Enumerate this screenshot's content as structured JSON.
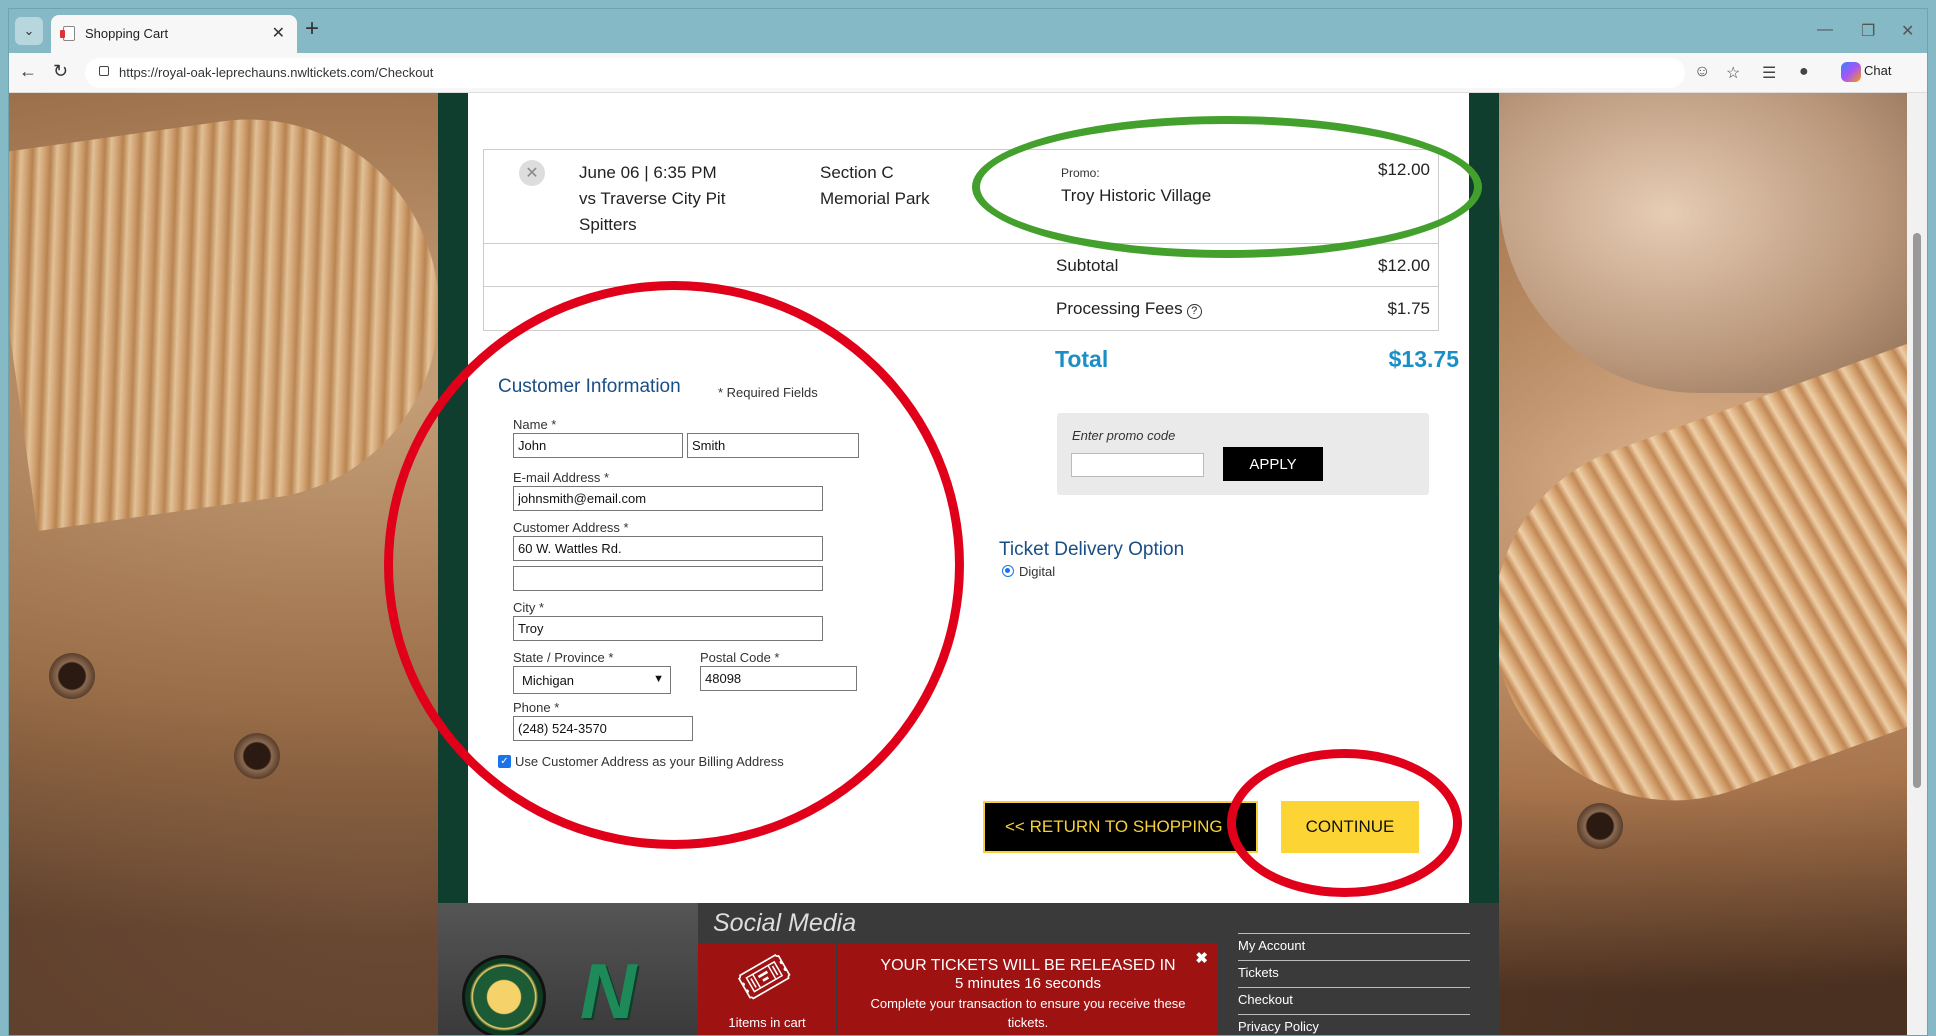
{
  "browser": {
    "tab_title": "Shopping Cart",
    "url": "https://royal-oak-leprechauns.nwltickets.com/Checkout",
    "chat_label": "Chat"
  },
  "cart": {
    "item": {
      "event": "June 06 | 6:35 PM\nvs Traverse City Pit\nSpitters",
      "section": "Section C",
      "venue": "Memorial Park",
      "promo_label": "Promo:",
      "promo_name": "Troy Historic Village",
      "price": "$12.00"
    },
    "subtotal_label": "Subtotal",
    "subtotal": "$12.00",
    "fees_label": "Processing Fees",
    "fees": "$1.75",
    "total_label": "Total",
    "total": "$13.75"
  },
  "promo": {
    "label": "Enter promo code",
    "apply": "APPLY"
  },
  "customer": {
    "title": "Customer Information",
    "required_note": "* Required Fields",
    "name_label": "Name *",
    "first_name": "John",
    "last_name": "Smith",
    "email_label": "E-mail Address *",
    "email": "johnsmith@email.com",
    "address_label": "Customer Address *",
    "address1": "60 W. Wattles Rd.",
    "address2": "",
    "city_label": "City *",
    "city": "Troy",
    "state_label": "State / Province *",
    "state": "Michigan",
    "postal_label": "Postal Code *",
    "postal": "48098",
    "phone_label": "Phone *",
    "phone": "(248) 524-3570",
    "billing_checkbox": "Use Customer Address as your Billing Address"
  },
  "delivery": {
    "title": "Ticket Delivery Option",
    "option": "Digital"
  },
  "actions": {
    "return": "<< RETURN TO SHOPPING",
    "continue": "CONTINUE"
  },
  "footer": {
    "social_title": "Social Media",
    "items_in_cart": "1items in cart",
    "timer_line1": "YOUR TICKETS WILL BE RELEASED IN",
    "timer_line2": "5 minutes 16 seconds",
    "timer_line3": "Complete your transaction to ensure you receive these tickets.",
    "links": [
      "My Account",
      "Tickets",
      "Checkout",
      "Privacy Policy"
    ]
  },
  "colors": {
    "accent_blue": "#1a8fc6",
    "heading_blue": "#1a4f85",
    "continue_yellow": "#fcd535",
    "timer_red": "#9e1212",
    "annotation_red": "#e1001a",
    "annotation_green": "#43a02c"
  }
}
